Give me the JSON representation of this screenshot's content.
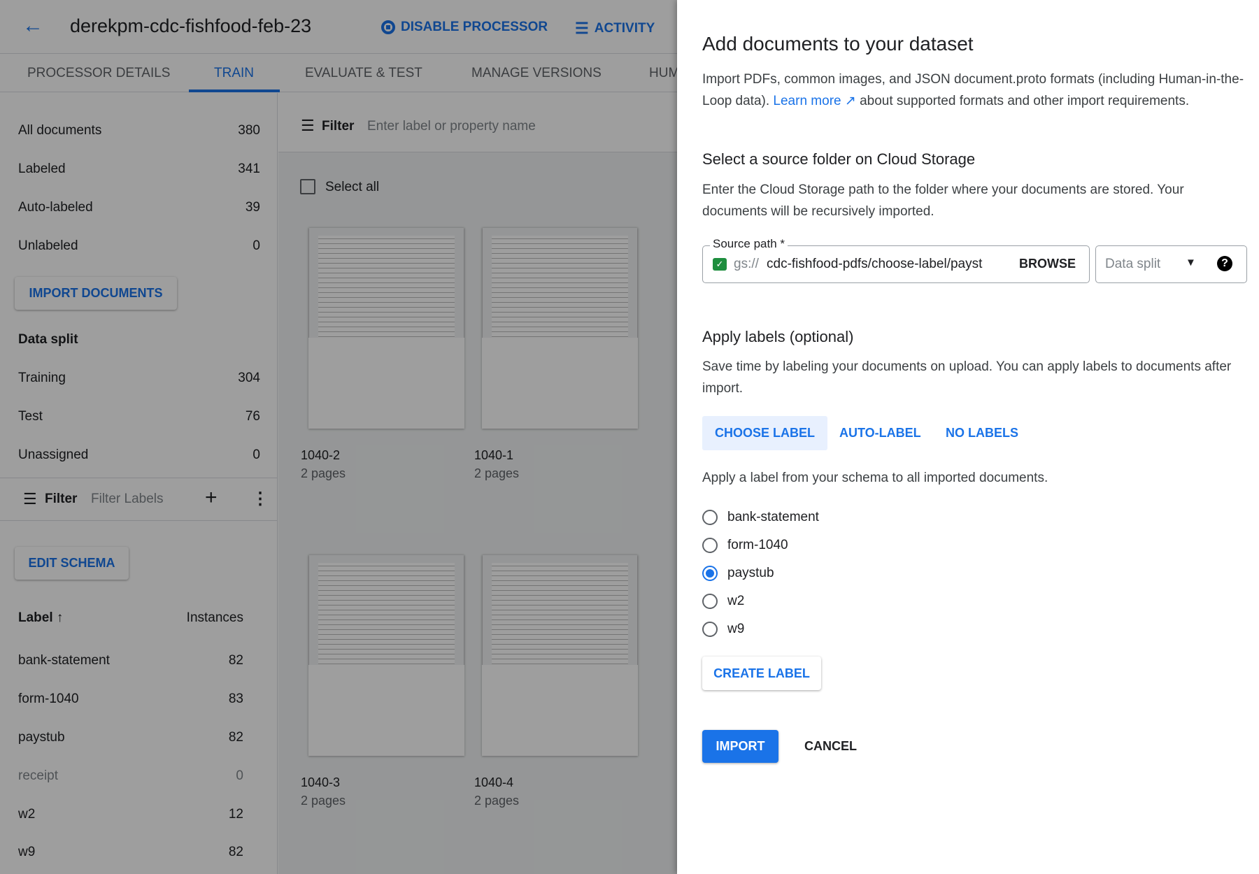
{
  "header": {
    "title": "derekpm-cdc-fishfood-feb-23",
    "disable_label": "DISABLE PROCESSOR",
    "activity_label": "ACTIVITY"
  },
  "tabs": [
    "PROCESSOR DETAILS",
    "TRAIN",
    "EVALUATE & TEST",
    "MANAGE VERSIONS",
    "HUM"
  ],
  "sidebar": {
    "counts": [
      {
        "label": "All documents",
        "count": "380"
      },
      {
        "label": "Labeled",
        "count": "341"
      },
      {
        "label": "Auto-labeled",
        "count": "39"
      },
      {
        "label": "Unlabeled",
        "count": "0"
      }
    ],
    "import_label": "IMPORT DOCUMENTS",
    "data_split_title": "Data split",
    "splits": [
      {
        "label": "Training",
        "count": "304"
      },
      {
        "label": "Test",
        "count": "76"
      },
      {
        "label": "Unassigned",
        "count": "0"
      }
    ],
    "filter_label": "Filter",
    "filter_placeholder": "Filter Labels",
    "edit_schema_label": "EDIT SCHEMA",
    "label_header": "Label",
    "instances_header": "Instances",
    "labels": [
      {
        "label": "bank-statement",
        "count": "82"
      },
      {
        "label": "form-1040",
        "count": "83"
      },
      {
        "label": "paystub",
        "count": "82"
      },
      {
        "label": "receipt",
        "count": "0"
      },
      {
        "label": "w2",
        "count": "12"
      },
      {
        "label": "w9",
        "count": "82"
      }
    ]
  },
  "main": {
    "filter_label": "Filter",
    "filter_placeholder": "Enter label or property name",
    "select_all": "Select all",
    "documents": [
      {
        "name": "1040-2",
        "pages": "2 pages"
      },
      {
        "name": "1040-1",
        "pages": "2 pages"
      },
      {
        "name": "1040-3",
        "pages": "2 pages"
      },
      {
        "name": "1040-4",
        "pages": "2 pages"
      }
    ]
  },
  "panel": {
    "title": "Add documents to your dataset",
    "intro_1": "Import PDFs, common images, and JSON document.proto formats (including Human-in-the-Loop data).",
    "learn_more": "Learn more",
    "intro_2": "about supported formats and other import requirements.",
    "source_title": "Select a source folder on Cloud Storage",
    "source_desc": "Enter the Cloud Storage path to the folder where your documents are stored. Your documents will be recursively imported.",
    "source_label": "Source path *",
    "source_prefix": "gs://",
    "source_value": "cdc-fishfood-pdfs/choose-label/payst",
    "browse": "BROWSE",
    "data_split_placeholder": "Data split",
    "labels_title": "Apply labels (optional)",
    "labels_desc": "Save time by labeling your documents on upload. You can apply labels to documents after import.",
    "label_tabs": [
      "CHOOSE LABEL",
      "AUTO-LABEL",
      "NO LABELS"
    ],
    "choose_desc": "Apply a label from your schema to all imported documents.",
    "options": [
      "bank-statement",
      "form-1040",
      "paystub",
      "w2",
      "w9"
    ],
    "selected": "paystub",
    "create_label": "CREATE LABEL",
    "import": "IMPORT",
    "cancel": "CANCEL",
    "colors": {
      "accent": "#1a73e8",
      "check": "#1e8e3e"
    }
  }
}
